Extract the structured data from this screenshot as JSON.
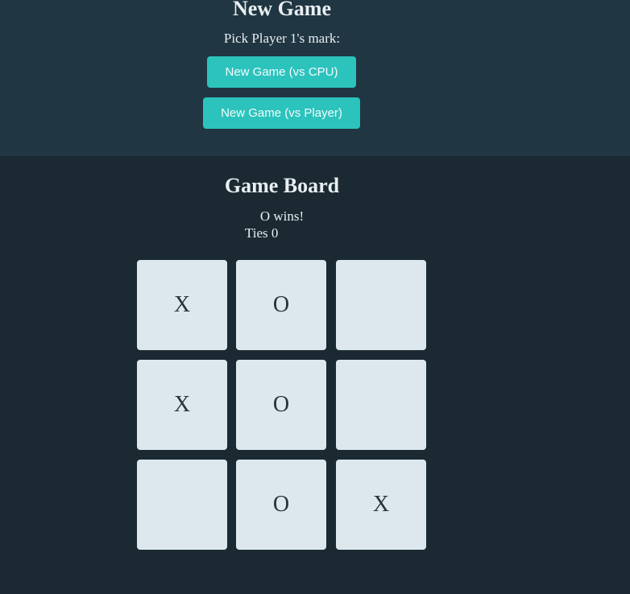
{
  "new_game": {
    "title": "New Game",
    "pick_label": "Pick Player 1's mark:",
    "vs_cpu_label": "New Game (vs CPU)",
    "vs_player_label": "New Game (vs Player)"
  },
  "board": {
    "title": "Game Board",
    "status": "O wins!",
    "ties": "Ties 0",
    "cells": [
      "X",
      "O",
      "",
      "X",
      "O",
      "",
      "",
      "O",
      "X"
    ]
  },
  "colors": {
    "top_background": "#203642",
    "bottom_background": "#1b2a32",
    "accent": "#2cc3bd",
    "cell_background": "#dce8ee",
    "mark_color": "#25343b"
  }
}
